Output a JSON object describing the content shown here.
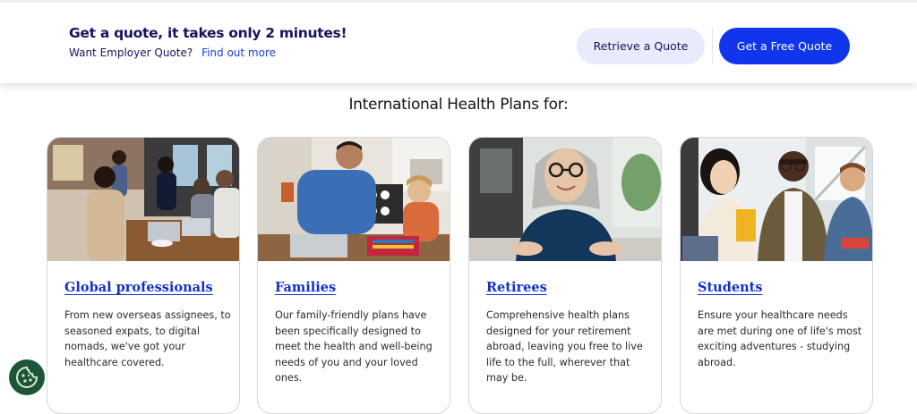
{
  "quote_banner": {
    "title": "Get a quote, it takes only 2 minutes!",
    "employer_prompt": "Want Employer Quote?",
    "employer_link": "Find out more",
    "retrieve_button": "Retrieve a Quote",
    "free_button": "Get a Free Quote"
  },
  "plans_section": {
    "heading": "International Health Plans for:",
    "cards": [
      {
        "title": "Global professionals",
        "description": "From new overseas assignees, to seasoned expats, to digital nomads, we've got your healthcare covered."
      },
      {
        "title": "Families",
        "description": "Our family-friendly plans have been specifically designed to meet the health and well-being needs of you and your loved ones."
      },
      {
        "title": "Retirees",
        "description": "Comprehensive health plans designed for your retirement abroad, leaving you free to live life to the full, wherever that may be."
      },
      {
        "title": "Students",
        "description": "Ensure your healthcare needs are met during one of life's most exciting adventures - studying abroad."
      }
    ]
  },
  "cookie_settings": {
    "icon": "cookie-icon"
  },
  "colors": {
    "brand_navy": "#14145e",
    "primary_blue": "#1035ec",
    "link_blue": "#1330c8",
    "retrieve_bg": "#e7ebfb",
    "cookie_green": "#1d5636"
  }
}
